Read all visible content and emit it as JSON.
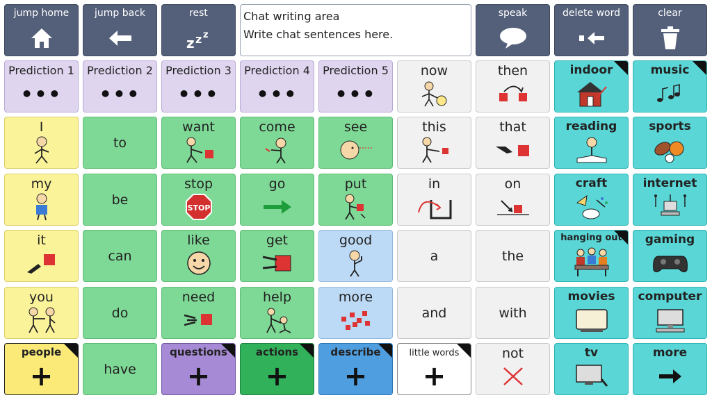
{
  "toolbar": {
    "jump_home": "jump home",
    "jump_back": "jump back",
    "rest": "rest",
    "speak": "speak",
    "delete_word": "delete word",
    "clear": "clear"
  },
  "chat": {
    "title": "Chat writing area",
    "placeholder": "Write chat sentences here."
  },
  "predictions": [
    "Prediction 1",
    "Prediction 2",
    "Prediction 3",
    "Prediction 4",
    "Prediction 5"
  ],
  "words": {
    "now": "now",
    "then": "then",
    "I": "I",
    "to": "to",
    "want": "want",
    "come": "come",
    "see": "see",
    "this": "this",
    "that": "that",
    "my": "my",
    "be": "be",
    "stop": "stop",
    "go": "go",
    "put": "put",
    "in": "in",
    "on": "on",
    "it": "it",
    "can": "can",
    "like": "like",
    "get": "get",
    "good": "good",
    "a": "a",
    "the": "the",
    "you": "you",
    "do": "do",
    "need": "need",
    "help": "help",
    "more": "more",
    "and": "and",
    "with": "with",
    "have": "have",
    "not": "not"
  },
  "topics": {
    "indoor": "indoor",
    "music": "music",
    "reading": "reading",
    "sports": "sports",
    "craft": "craft",
    "internet": "internet",
    "hanging_out": "hanging out",
    "gaming": "gaming",
    "movies": "movies",
    "computer": "computer",
    "tv": "tv",
    "more": "more"
  },
  "categories": {
    "people": "people",
    "questions": "questions",
    "actions": "actions",
    "describe": "describe",
    "little_words": "little words"
  },
  "stop_sign": "STOP",
  "colors": {
    "toolbar": "#54607a",
    "yellow": "#fbf39a",
    "green": "#7fd996",
    "purple": "#dfd5ef",
    "blue": "#bcd9f5",
    "grey": "#f1f1f1",
    "teal": "#5ad6d6"
  }
}
